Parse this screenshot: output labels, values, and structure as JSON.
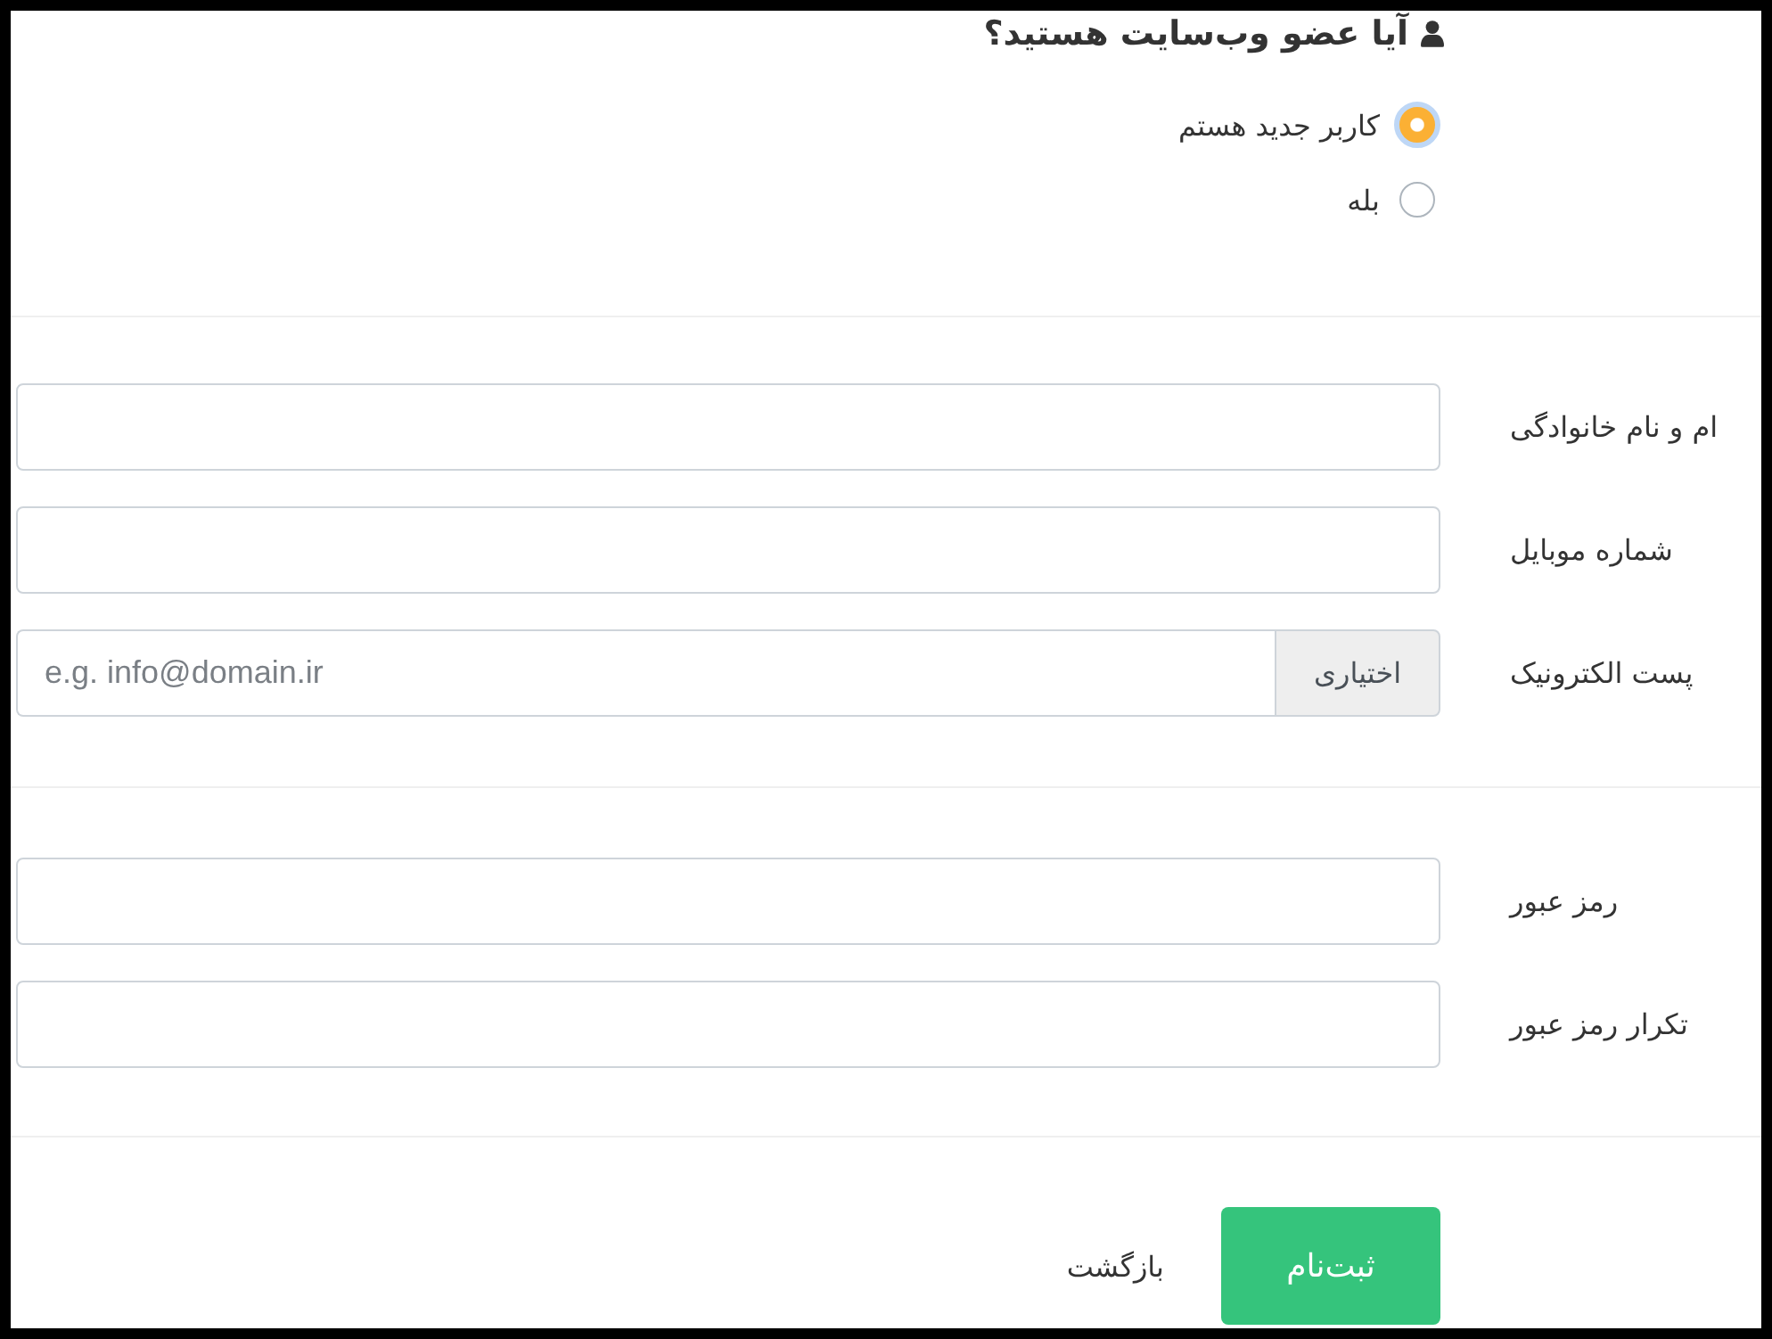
{
  "title": "آیا عضو وب‌سایت هستید؟",
  "membership_options": [
    {
      "label": "کاربر جدید هستم",
      "selected": true
    },
    {
      "label": "بله",
      "selected": false
    }
  ],
  "sections": [
    {
      "fields": [
        {
          "label": "ام و نام خانوادگی"
        },
        {
          "label": "شماره موبایل"
        },
        {
          "label": "پست الکترونیک",
          "addon": "اختیاری",
          "placeholder": "e.g. info@domain.ir"
        }
      ]
    },
    {
      "fields": [
        {
          "label": "رمز عبور"
        },
        {
          "label": "تکرار رمز عبور"
        }
      ]
    }
  ],
  "buttons": [
    {
      "kind": "primary",
      "label": "ثبت‌نام"
    },
    {
      "kind": "link",
      "label": "بازگشت"
    }
  ]
}
